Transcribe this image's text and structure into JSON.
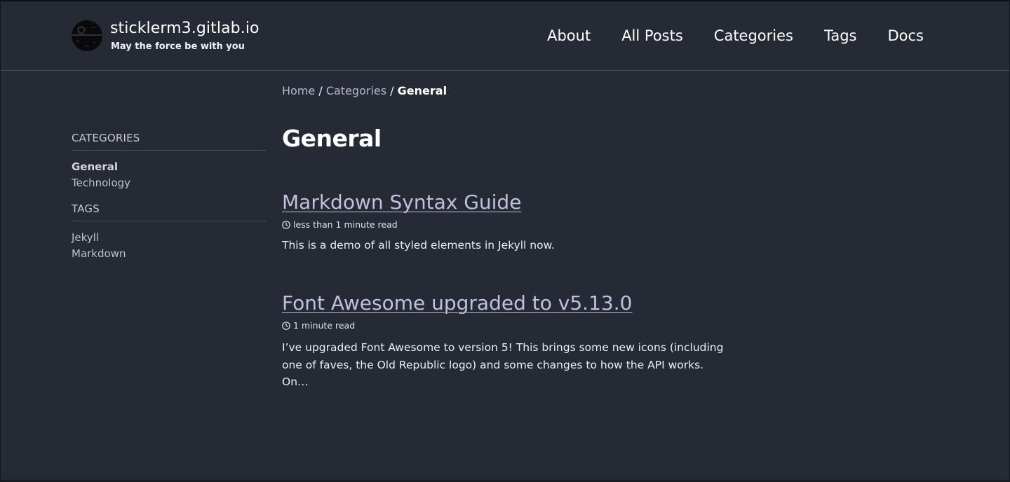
{
  "site": {
    "title": "sticklerm3.gitlab.io",
    "subtitle": "May the force be with you"
  },
  "nav": {
    "about": "About",
    "all_posts": "All Posts",
    "categories": "Categories",
    "tags": "Tags",
    "docs": "Docs"
  },
  "breadcrumb": {
    "home": "Home",
    "sep1": "/",
    "categories": "Categories",
    "sep2": "/",
    "current": "General"
  },
  "sidebar": {
    "categories_heading": "CATEGORIES",
    "categories": [
      "General",
      "Technology"
    ],
    "tags_heading": "TAGS",
    "tags": [
      "Jekyll",
      "Markdown"
    ]
  },
  "main": {
    "heading": "General",
    "posts": [
      {
        "title": "Markdown Syntax Guide",
        "read_time": "less than 1 minute read",
        "excerpt": "This is a demo of all styled elements in Jekyll now."
      },
      {
        "title": "Font Awesome upgraded to v5.13.0",
        "read_time": "1 minute read",
        "excerpt": "I’ve upgraded Font Awesome to version 5! This brings some new icons (including one of faves, the Old Republic logo) and some changes to how the API works. On…"
      }
    ]
  },
  "icons": {
    "logo": "death-star-icon",
    "read_time": "clock-icon"
  }
}
